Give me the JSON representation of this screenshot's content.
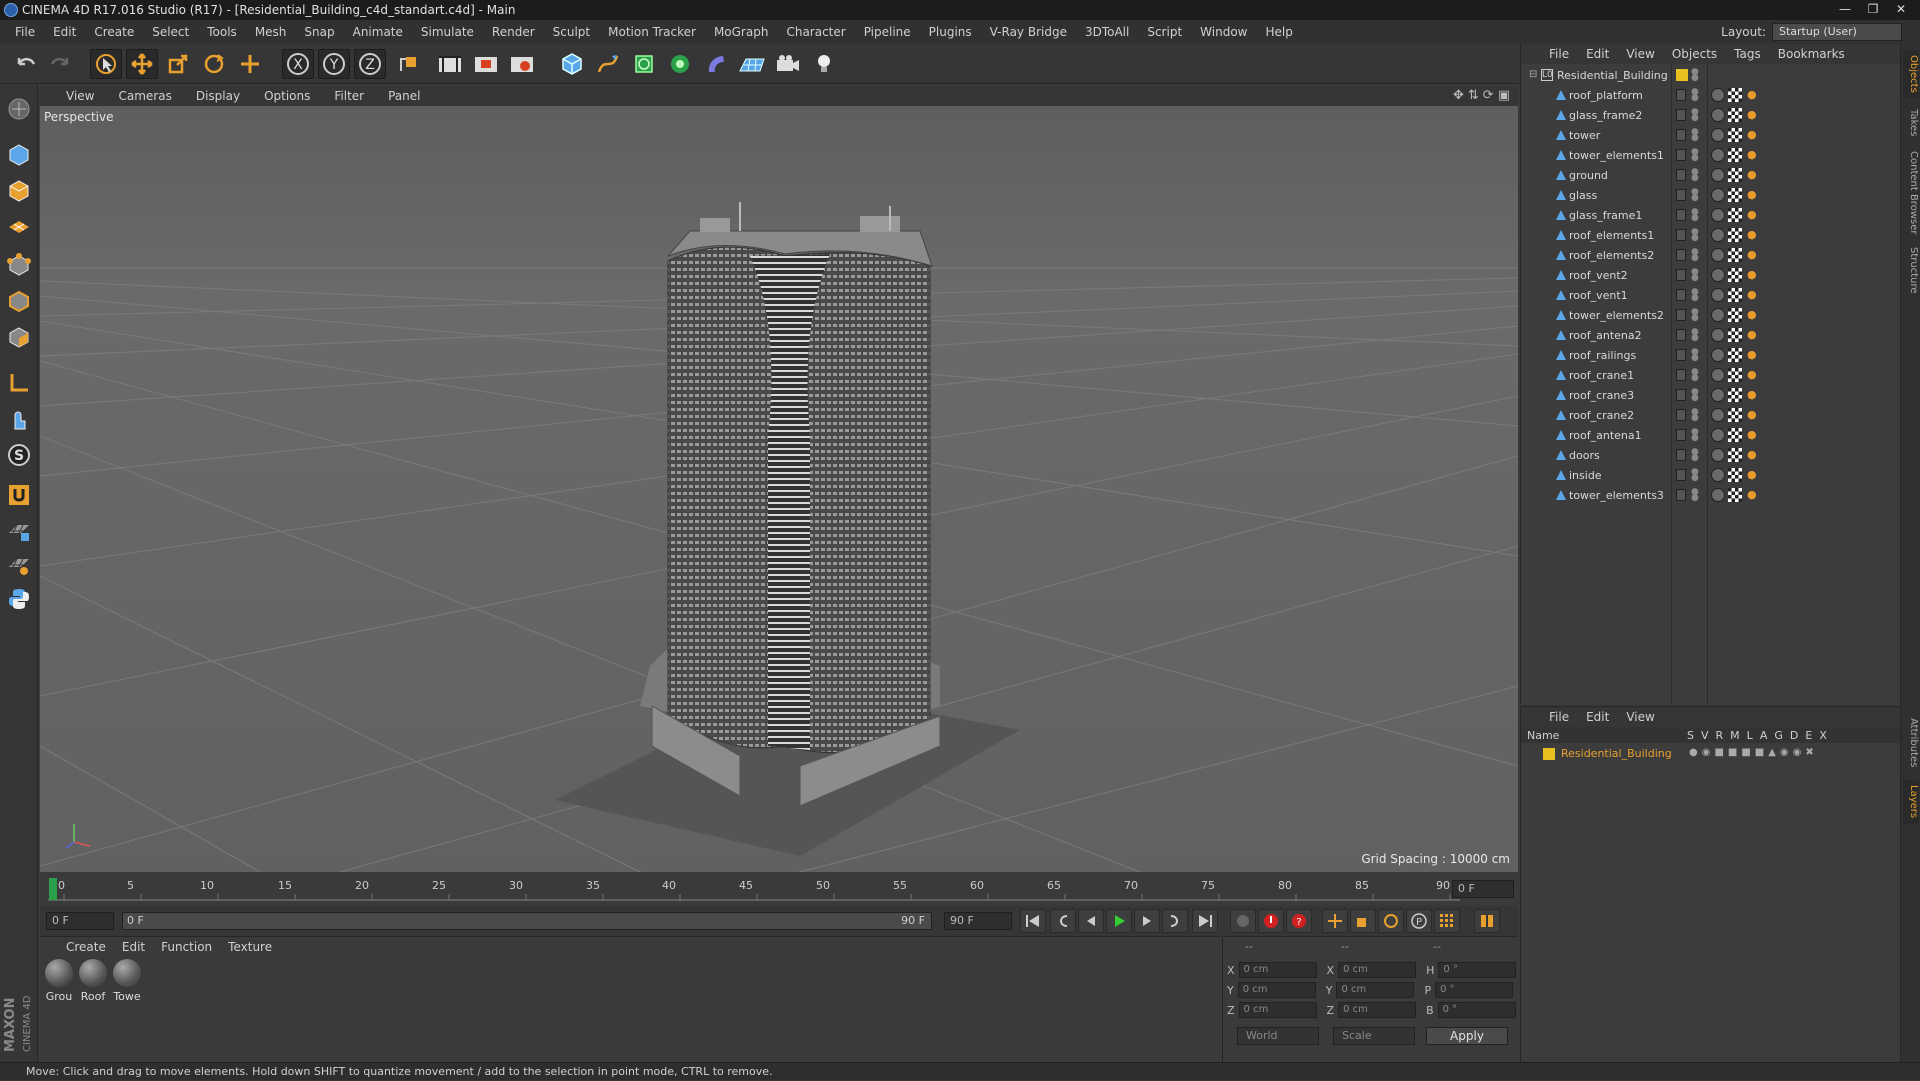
{
  "window": {
    "title": "CINEMA 4D R17.016 Studio (R17) - [Residential_Building_c4d_standart.c4d] - Main"
  },
  "menu": [
    "File",
    "Edit",
    "Create",
    "Select",
    "Tools",
    "Mesh",
    "Snap",
    "Animate",
    "Simulate",
    "Render",
    "Sculpt",
    "Motion Tracker",
    "MoGraph",
    "Character",
    "Pipeline",
    "Plugins",
    "V-Ray Bridge",
    "3DToAll",
    "Script",
    "Window",
    "Help"
  ],
  "layout": {
    "label": "Layout:",
    "value": "Startup (User)"
  },
  "viewport": {
    "menu": [
      "View",
      "Cameras",
      "Display",
      "Options",
      "Filter",
      "Panel"
    ],
    "label": "Perspective",
    "grid_spacing": "Grid Spacing : 10000 cm"
  },
  "timeline": {
    "ticks": [
      "0",
      "5",
      "10",
      "15",
      "20",
      "25",
      "30",
      "35",
      "40",
      "45",
      "50",
      "55",
      "60",
      "65",
      "70",
      "75",
      "80",
      "85",
      "90"
    ],
    "current_frame": "0 F",
    "start_field": "0 F",
    "range_start": "0 F",
    "range_end": "90 F",
    "end_field": "90 F"
  },
  "materials": {
    "menu": [
      "Create",
      "Edit",
      "Function",
      "Texture"
    ],
    "items": [
      "Grou",
      "Roof",
      "Towe"
    ]
  },
  "coords": {
    "headers": [
      "--",
      "--",
      "--"
    ],
    "rows": [
      {
        "a": "X",
        "av": "0 cm",
        "b": "X",
        "bv": "0 cm",
        "c": "H",
        "cv": "0 °"
      },
      {
        "a": "Y",
        "av": "0 cm",
        "b": "Y",
        "bv": "0 cm",
        "c": "P",
        "cv": "0 °"
      },
      {
        "a": "Z",
        "av": "0 cm",
        "b": "Z",
        "bv": "0 cm",
        "c": "B",
        "cv": "0 °"
      }
    ],
    "space": "World",
    "mode": "Scale",
    "apply": "Apply"
  },
  "object_manager": {
    "menu": [
      "File",
      "Edit",
      "View",
      "Objects",
      "Tags",
      "Bookmarks"
    ],
    "root": "Residential_Building",
    "objects": [
      "roof_platform",
      "glass_frame2",
      "tower",
      "tower_elements1",
      "ground",
      "glass",
      "glass_frame1",
      "roof_elements1",
      "roof_elements2",
      "roof_vent2",
      "roof_vent1",
      "tower_elements2",
      "roof_antena2",
      "roof_railings",
      "roof_crane1",
      "roof_crane3",
      "roof_crane2",
      "roof_antena1",
      "doors",
      "inside",
      "tower_elements3"
    ]
  },
  "layer_manager": {
    "menu": [
      "File",
      "Edit",
      "View"
    ],
    "name_header": "Name",
    "columns": [
      "S",
      "V",
      "R",
      "M",
      "L",
      "A",
      "G",
      "D",
      "E",
      "X"
    ],
    "layer": "Residential_Building"
  },
  "right_tabs": [
    "Objects",
    "Takes",
    "Content Browser",
    "Structure",
    "Attributes",
    "Layers"
  ],
  "status": "Move: Click and drag to move elements. Hold down SHIFT to quantize movement / add to the selection in point mode, CTRL to remove.",
  "brand": {
    "line1": "MAXON",
    "line2": "CINEMA 4D"
  },
  "colors": {
    "accent": "#e8a030",
    "layer": "#e8c020"
  }
}
